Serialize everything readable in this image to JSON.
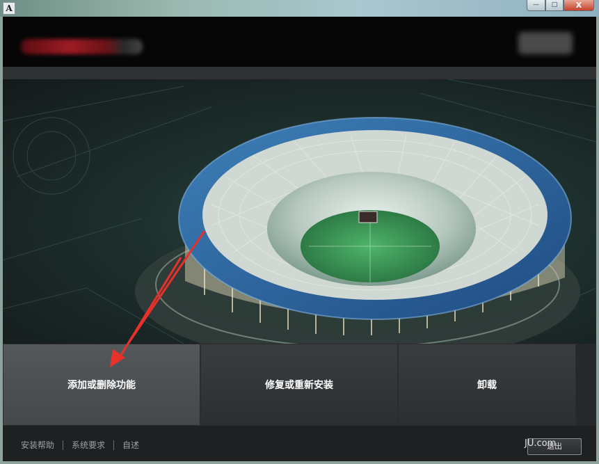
{
  "window": {
    "app_icon_letter": "A",
    "controls": {
      "minimize": "—",
      "maximize": "□",
      "close": "X"
    }
  },
  "actions": {
    "add_remove": "添加或删除功能",
    "repair_reinstall": "修复或重新安装",
    "uninstall": "卸载"
  },
  "footer": {
    "links": [
      "安装帮助",
      "系统要求",
      "自述"
    ],
    "exit_label": "退出",
    "watermark": "JU.com"
  },
  "colors": {
    "annotation_arrow": "#e8312a",
    "close_button": "#c4422c",
    "selected_tile": "#4d5053"
  }
}
